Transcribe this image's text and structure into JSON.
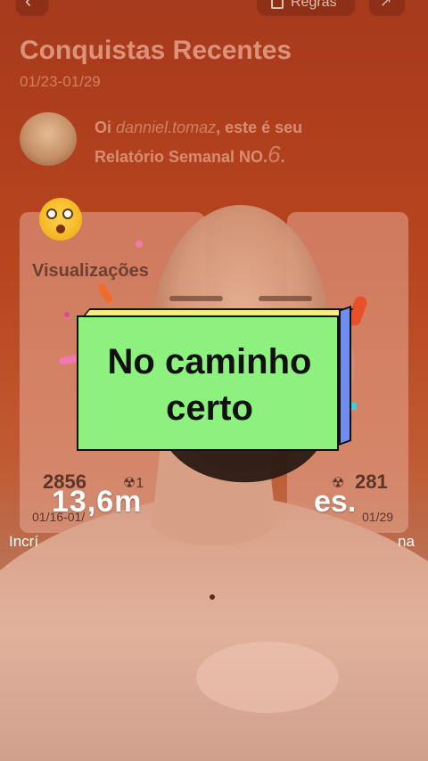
{
  "header": {
    "back_icon": "chevron-left-icon",
    "rules_label": "Regras",
    "rules_icon": "document-icon",
    "share_icon": "trend-icon"
  },
  "report": {
    "title": "Conquistas Recentes",
    "date_range": "01/23-01/29",
    "greeting_prefix": "Oi ",
    "username": "danniel.tomaz",
    "greeting_mid": ", este é seu",
    "greeting_line2": "Relatório Semanal NO.",
    "report_number": "6",
    "greeting_end": "."
  },
  "stats": {
    "views_label": "Visualizações",
    "views_left": "2856",
    "views_right": "281",
    "radiation_left": "☢1",
    "radiation_right": "☢",
    "period_left": "01/16-01/",
    "period_right": "01/29"
  },
  "overlay_text": {
    "big_number": "13,6m",
    "big_suffix": "es.",
    "sub_left": "Incrí",
    "sub_right": "na"
  },
  "sticker": {
    "line1": "No caminho",
    "line2": "certo"
  },
  "colors": {
    "background": "#b8451f",
    "sticker_front": "#8cf27d",
    "sticker_side": "#6f8df0",
    "sticker_top": "#f2ef7a"
  }
}
